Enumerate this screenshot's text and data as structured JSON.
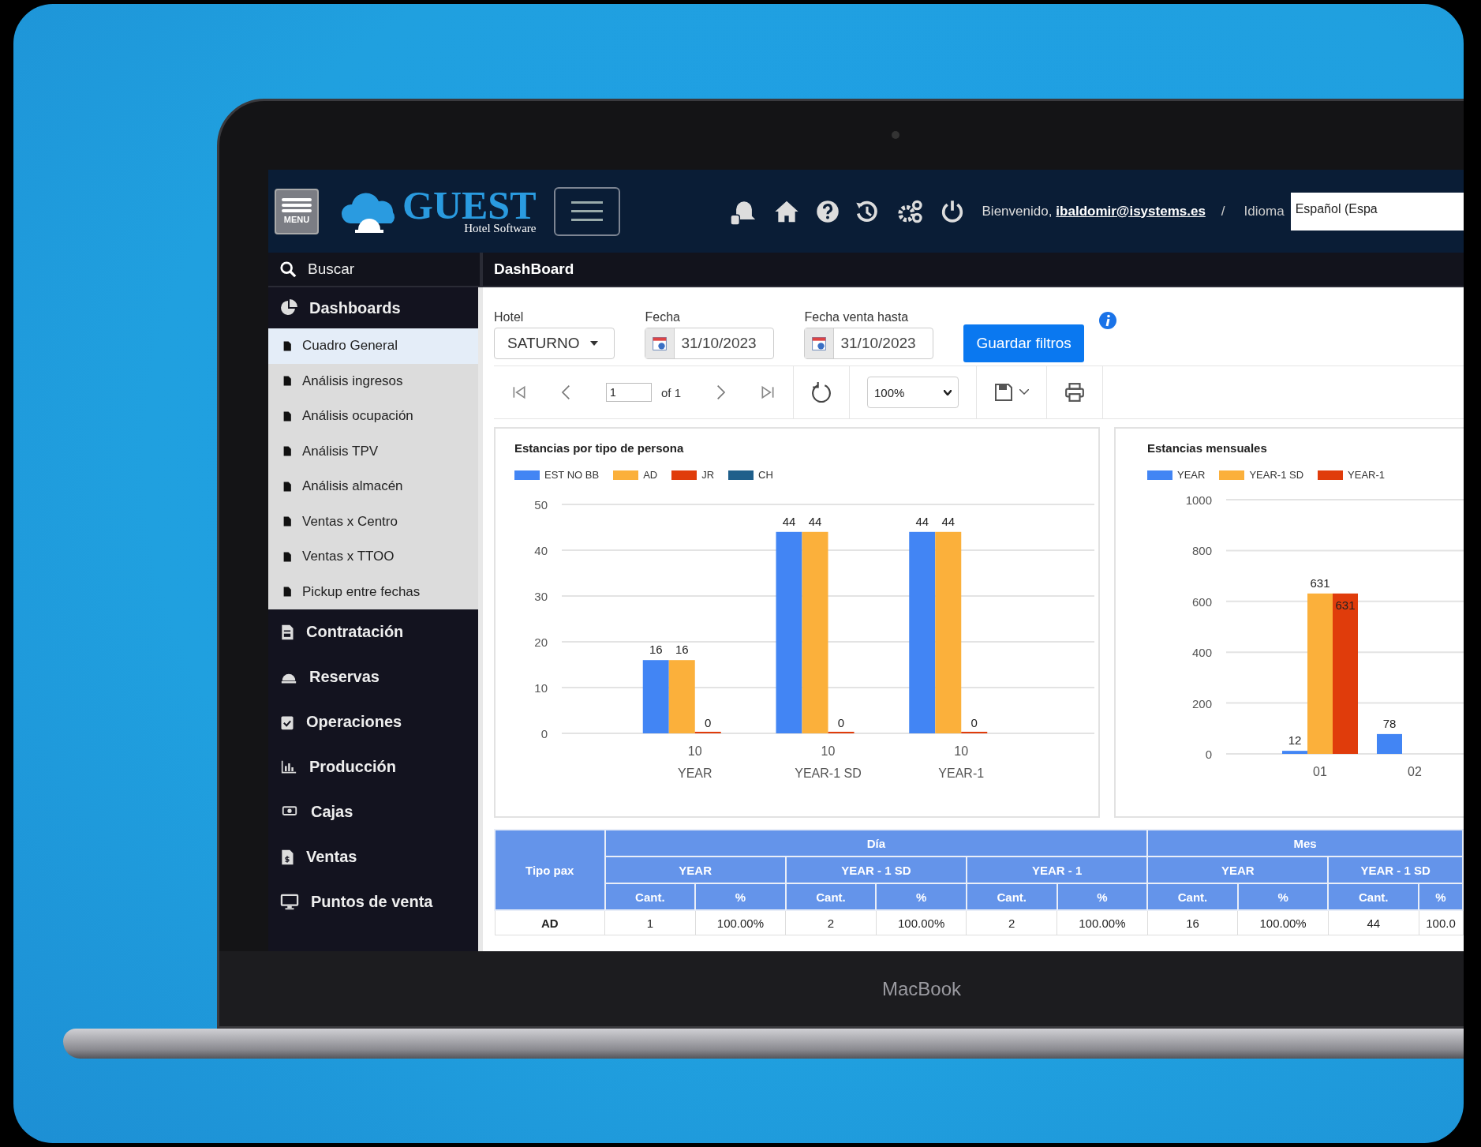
{
  "header": {
    "menu_button": "MENU",
    "logo": {
      "name": "GUEST",
      "tagline": "Hotel Software"
    },
    "welcome": "Bienvenido,",
    "user_link": "ibaldomir@isystems.es",
    "separator": "/",
    "language_label": "Idioma",
    "language_value": "Español (Espa"
  },
  "search": {
    "label": "Buscar"
  },
  "page_title": "DashBoard",
  "sidebar": {
    "items": [
      {
        "label": "Dashboards",
        "expanded": true,
        "children": [
          {
            "label": "Cuadro General",
            "selected": true
          },
          {
            "label": "Análisis ingresos",
            "selected": false
          },
          {
            "label": "Análisis ocupación",
            "selected": false
          },
          {
            "label": "Análisis TPV",
            "selected": false
          },
          {
            "label": "Análisis almacén",
            "selected": false
          },
          {
            "label": "Ventas x Centro",
            "selected": false
          },
          {
            "label": "Ventas x TTOO",
            "selected": false
          },
          {
            "label": "Pickup entre fechas",
            "selected": false
          }
        ]
      },
      {
        "label": "Contratación"
      },
      {
        "label": "Reservas"
      },
      {
        "label": "Operaciones"
      },
      {
        "label": "Producción"
      },
      {
        "label": "Cajas"
      },
      {
        "label": "Ventas"
      },
      {
        "label": "Puntos de venta"
      }
    ]
  },
  "filters": {
    "hotel": {
      "label": "Hotel",
      "value": "SATURNO"
    },
    "date": {
      "label": "Fecha",
      "value": "31/10/2023"
    },
    "sale_date": {
      "label": "Fecha venta hasta",
      "value": "31/10/2023"
    },
    "save_button": "Guardar filtros"
  },
  "toolbar": {
    "page": "1",
    "page_count": "of 1",
    "zoom": "100%"
  },
  "charts": [
    {
      "chart_data": {
        "type": "bar",
        "title": "Estancias por tipo de persona",
        "categories": [
          "10\nYEAR",
          "10\nYEAR-1 SD",
          "10\nYEAR-1"
        ],
        "grid": true,
        "ylim": [
          0,
          50
        ],
        "yticks": [
          0,
          10,
          20,
          30,
          40,
          50
        ],
        "data_labels": true,
        "series": [
          {
            "name": "EST NO BB",
            "color": "#4285f4",
            "values": [
              16,
              44,
              44
            ]
          },
          {
            "name": "AD",
            "color": "#fbb03b",
            "values": [
              16,
              44,
              44
            ]
          },
          {
            "name": "JR",
            "color": "#e03c0b",
            "values": [
              0,
              0,
              0
            ]
          },
          {
            "name": "CH",
            "color": "#1f5f8b",
            "values": [
              null,
              null,
              null
            ]
          }
        ]
      }
    },
    {
      "chart_data": {
        "type": "bar",
        "title": "Estancias mensuales",
        "categories": [
          "01",
          "02"
        ],
        "grid": true,
        "ylim": [
          0,
          1000
        ],
        "yticks": [
          0,
          200,
          400,
          600,
          800,
          1000
        ],
        "data_labels": true,
        "series": [
          {
            "name": "YEAR",
            "color": "#4285f4",
            "values": [
              12,
              78
            ]
          },
          {
            "name": "YEAR-1 SD",
            "color": "#fbb03b",
            "values": [
              631,
              null
            ]
          },
          {
            "name": "YEAR-1",
            "color": "#e03c0b",
            "values": [
              631,
              null
            ]
          }
        ]
      }
    }
  ],
  "table": {
    "first_column": "Tipo pax",
    "groups": [
      {
        "label": "Día",
        "subgroups": [
          {
            "label": "YEAR",
            "columns": [
              "Cant.",
              "%"
            ]
          },
          {
            "label": "YEAR - 1 SD",
            "columns": [
              "Cant.",
              "%"
            ]
          },
          {
            "label": "YEAR - 1",
            "columns": [
              "Cant.",
              "%"
            ]
          }
        ]
      },
      {
        "label": "Mes",
        "subgroups": [
          {
            "label": "YEAR",
            "columns": [
              "Cant.",
              "%"
            ]
          },
          {
            "label": "YEAR - 1 SD",
            "columns": [
              "Cant.",
              "%"
            ]
          }
        ]
      }
    ],
    "rows": [
      {
        "cells": [
          "AD",
          "1",
          "100.00%",
          "2",
          "100.00%",
          "2",
          "100.00%",
          "16",
          "100.00%",
          "44",
          "100.0"
        ]
      }
    ]
  },
  "device_label": "MacBook"
}
